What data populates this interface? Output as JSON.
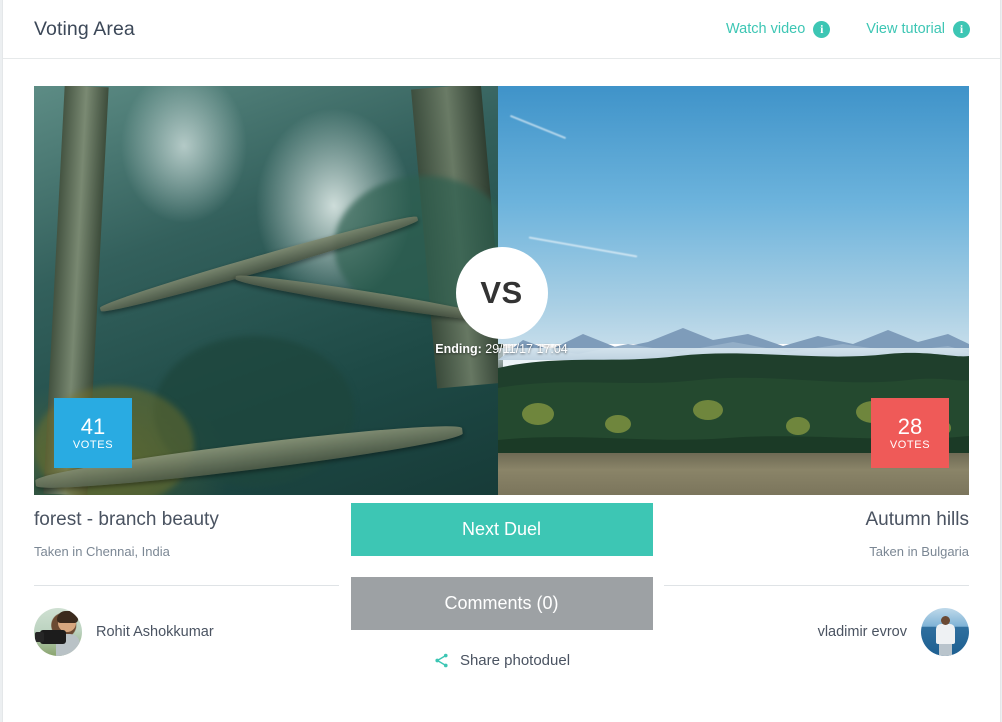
{
  "header": {
    "title": "Voting Area",
    "links": [
      {
        "label": "Watch video",
        "icon": "info-icon",
        "glyph": "i"
      },
      {
        "label": "View tutorial",
        "icon": "info-icon",
        "glyph": "i"
      }
    ]
  },
  "duel": {
    "vs_label": "VS",
    "ending_prefix": "Ending:",
    "ending_value": "29/11/17 17:04",
    "left": {
      "votes": "41",
      "votes_label": "VOTES",
      "votes_color": "#29ABE2",
      "title": "forest - branch beauty",
      "location": "Taken in Chennai, India",
      "author": "Rohit Ashokkumar",
      "avatar": "photographer-avatar"
    },
    "right": {
      "votes": "28",
      "votes_label": "VOTES",
      "votes_color": "#ef5a58",
      "title": "Autumn hills",
      "location": "Taken in Bulgaria",
      "author": "vladimir evrov",
      "avatar": "sea-portrait-avatar"
    }
  },
  "actions": {
    "next_duel": "Next Duel",
    "comments": "Comments (0)",
    "share": "Share photoduel",
    "share_icon": "share-icon",
    "next_color": "#3dc6b4",
    "comments_color": "#9da1a4"
  },
  "theme": {
    "accent": "#3dc6b4",
    "text": "#4a5361",
    "muted": "#7b8794"
  }
}
